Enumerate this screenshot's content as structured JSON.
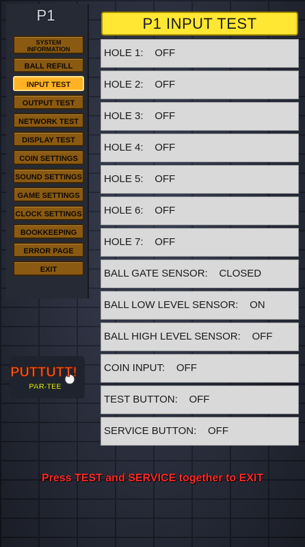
{
  "player_label": "P1",
  "title": "P1 INPUT TEST",
  "menu": [
    {
      "label": "SYSTEM INFORMATION",
      "name": "menu-system-information",
      "tall": true,
      "active": false
    },
    {
      "label": "BALL REFILL",
      "name": "menu-ball-refill",
      "active": false
    },
    {
      "label": "INPUT TEST",
      "name": "menu-input-test",
      "active": true
    },
    {
      "label": "OUTPUT TEST",
      "name": "menu-output-test",
      "active": false
    },
    {
      "label": "NETWORK TEST",
      "name": "menu-network-test",
      "active": false
    },
    {
      "label": "DISPLAY TEST",
      "name": "menu-display-test",
      "active": false
    },
    {
      "label": "COIN SETTINGS",
      "name": "menu-coin-settings",
      "active": false
    },
    {
      "label": "SOUND SETTINGS",
      "name": "menu-sound-settings",
      "active": false
    },
    {
      "label": "GAME SETTINGS",
      "name": "menu-game-settings",
      "active": false
    },
    {
      "label": "CLOCK SETTINGS",
      "name": "menu-clock-settings",
      "active": false
    },
    {
      "label": "BOOKKEEPING",
      "name": "menu-bookkeeping",
      "active": false
    },
    {
      "label": "ERROR PAGE",
      "name": "menu-error-page",
      "active": false
    },
    {
      "label": "EXIT",
      "name": "menu-exit",
      "active": false
    }
  ],
  "inputs": [
    {
      "label": "HOLE 1:",
      "value": "OFF"
    },
    {
      "label": "HOLE 2:",
      "value": "OFF"
    },
    {
      "label": "HOLE 3:",
      "value": "OFF"
    },
    {
      "label": "HOLE 4:",
      "value": "OFF"
    },
    {
      "label": "HOLE 5:",
      "value": "OFF"
    },
    {
      "label": "HOLE 6:",
      "value": "OFF"
    },
    {
      "label": "HOLE 7:",
      "value": "OFF"
    },
    {
      "label": "BALL GATE SENSOR:",
      "value": "CLOSED"
    },
    {
      "label": "BALL LOW LEVEL SENSOR:",
      "value": "ON"
    },
    {
      "label": "BALL HIGH LEVEL SENSOR:",
      "value": "OFF"
    },
    {
      "label": "COIN INPUT:",
      "value": "OFF"
    },
    {
      "label": "TEST BUTTON:",
      "value": "OFF"
    },
    {
      "label": "SERVICE BUTTON:",
      "value": "OFF"
    }
  ],
  "logo": {
    "line1": "PUTTUTT!",
    "line2": "PAR-TEE"
  },
  "footer": "Press TEST and SERVICE together to EXIT",
  "colors": {
    "accent": "#ffe733",
    "menu": "#8a5a12",
    "menu_active": "#ffb324",
    "footer": "#ff2a2a"
  }
}
